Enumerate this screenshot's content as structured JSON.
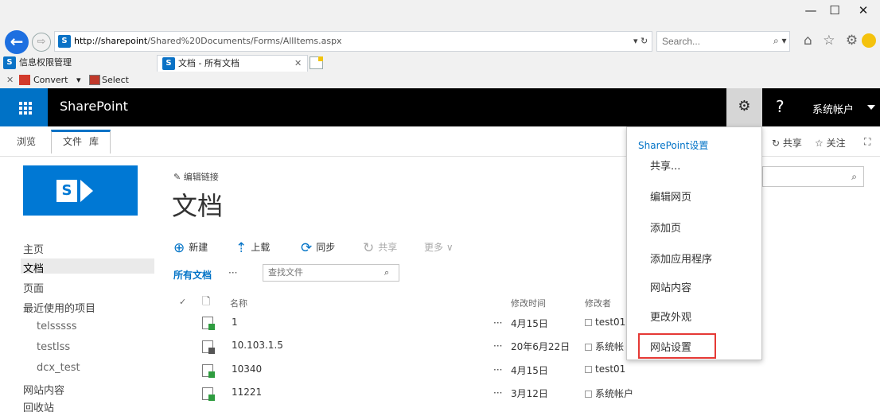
{
  "window": {
    "minimize_glyph": "—",
    "maximize_glyph": "☐",
    "close_glyph": "✕"
  },
  "browser": {
    "back_glyph": "←",
    "forward_glyph": "⇨",
    "url_host": "http://sharepoint",
    "url_path": "/Shared%20Documents/Forms/AllItems.aspx",
    "url_tools": "▾ ↻",
    "search_placeholder": "Search...",
    "search_glyph": "⌕ ▾",
    "right_icons": "⌂ ☆ ⚙"
  },
  "tabs": [
    {
      "label": "信息权限管理",
      "active": false
    },
    {
      "label": "文档 - 所有文档",
      "active": true,
      "close": "✕"
    }
  ],
  "commandbar": {
    "close_glyph": "✕",
    "convert_label": "Convert",
    "convert_caret": "▾",
    "select_label": "Select"
  },
  "suitebar": {
    "brand": "SharePoint",
    "gear_glyph": "⚙",
    "help_glyph": "?",
    "account": "系统帐户"
  },
  "ribbon": {
    "tabs": [
      "浏览",
      "文件",
      "库"
    ],
    "share": "共享",
    "follow": "关注",
    "share_icon": "↻",
    "follow_icon": "☆",
    "focus_icon": "⛶"
  },
  "leftnav": {
    "items": [
      {
        "label": "主页",
        "level": 0
      },
      {
        "label": "文档",
        "level": 0,
        "selected": true
      },
      {
        "label": "页面",
        "level": 0
      },
      {
        "label": "最近使用的项目",
        "level": 0
      },
      {
        "label": "telsssss",
        "level": 1
      },
      {
        "label": "testlss",
        "level": 1
      },
      {
        "label": "dcx_test",
        "level": 1
      },
      {
        "label": "网站内容",
        "level": 0
      },
      {
        "label": "回收站",
        "level": 0
      }
    ]
  },
  "main": {
    "edit_links": "编辑链接",
    "edit_icon": "✎",
    "title": "文档",
    "commands": [
      {
        "icon": "⊕",
        "label": "新建"
      },
      {
        "icon": "⇡",
        "label": "上载"
      },
      {
        "icon": "⟳",
        "label": "同步"
      },
      {
        "icon": "↻",
        "label": "共享",
        "disabled": true
      },
      {
        "icon": "",
        "label": "更多 ∨",
        "disabled": true
      }
    ],
    "view_label": "所有文档",
    "view_more": "···",
    "find_placeholder": "查找文件",
    "find_glyph": "⌕",
    "columns": {
      "check": "✓",
      "type": "🗋",
      "name": "名称",
      "modified": "修改时间",
      "modified_by": "修改者"
    },
    "rows": [
      {
        "name": "1",
        "dots": "···",
        "modified": "4月15日",
        "modified_by": "test01"
      },
      {
        "name": "10.103.1.5",
        "dots": "···",
        "modified": "20年6月22日",
        "modified_by": "系统帐"
      },
      {
        "name": "10340",
        "dots": "···",
        "modified": "4月15日",
        "modified_by": "test01"
      },
      {
        "name": "11221",
        "dots": "···",
        "modified": "3月12日",
        "modified_by": "系统帐户"
      }
    ]
  },
  "settings_menu": {
    "header": "SharePoint设置",
    "items": [
      "共享...",
      "编辑网页",
      "添加页",
      "添加应用程序",
      "网站内容",
      "更改外观",
      "网站设置"
    ],
    "highlighted": "网站设置",
    "highlight_color": "#e53935"
  },
  "right_search_glyph": "⌕",
  "colors": {
    "accent": "#0072c6",
    "suite_bg": "#000000"
  }
}
